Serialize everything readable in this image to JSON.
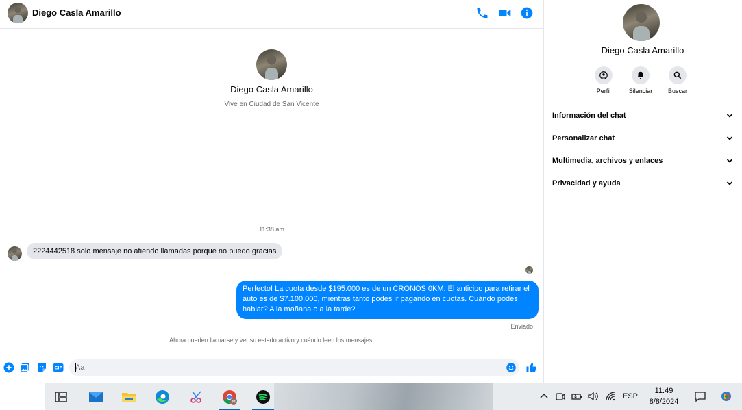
{
  "header": {
    "contact_name": "Diego Casla Amarillo",
    "icons": [
      "phone-icon",
      "video-call-icon",
      "info-icon"
    ]
  },
  "profile": {
    "name": "Diego Casla Amarillo",
    "subtitle": "Vive en Ciudad de San Vicente"
  },
  "messages": {
    "timestamp": "11:38 am",
    "incoming_text": "2224442518 solo mensaje no atiendo llamadas porque no puedo gracias",
    "outgoing_text": "Perfecto! La cuota desde $195.000 es de un CRONOS 0KM. El anticipo para retirar el auto es de $7.100.000, mientras tanto podes ir pagando en cuotas. Cuándo podes hablar? A la mañana o a la tarde?",
    "status": "Enviado",
    "notice": "Ahora pueden llamarse y ver su estado activo y cuándo leen los mensajes."
  },
  "composer": {
    "placeholder": "Aa",
    "icons": [
      "plus-icon",
      "photo-icon",
      "sticker-icon",
      "gif-icon",
      "emoji-icon",
      "thumbs-up-icon"
    ]
  },
  "info_panel": {
    "name": "Diego Casla Amarillo",
    "actions": [
      {
        "label": "Perfil",
        "icon": "profile-icon"
      },
      {
        "label": "Silenciar",
        "icon": "bell-icon"
      },
      {
        "label": "Buscar",
        "icon": "search-icon"
      }
    ],
    "sections": [
      "Información del chat",
      "Personalizar chat",
      "Multimedia, archivos y enlaces",
      "Privacidad y ayuda"
    ]
  },
  "taskbar": {
    "apps": [
      "task-view",
      "mail",
      "file-explorer",
      "edge",
      "snipping-tool",
      "chrome",
      "spotify"
    ],
    "language": "ESP",
    "time": "11:49",
    "date": "8/8/2024",
    "colors": {
      "accent": "#0084ff",
      "active_indicator": "#0067c0"
    }
  }
}
